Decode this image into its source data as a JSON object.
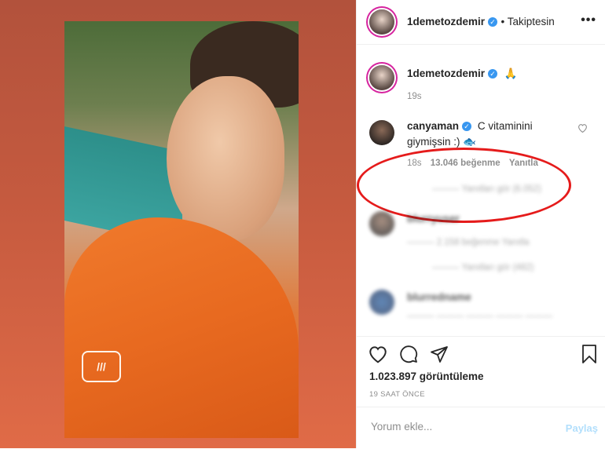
{
  "post": {
    "author": "1demetozdemir",
    "follow_label": "• Takiptesin",
    "more_label": "•••"
  },
  "caption": {
    "author": "1demetozdemir",
    "emoji": "🙏",
    "time": "19s"
  },
  "highlighted_comment": {
    "author": "canyaman",
    "text_line1": "C vitaminini",
    "text_line2": "giymişsin :)",
    "emoji": "🐟",
    "time": "18s",
    "likes": "13.046 beğenme",
    "reply": "Yanıtla"
  },
  "blurred_comments": [
    {
      "line": "——— Yanıtları gör (6.052)"
    },
    {
      "author": "blurryuser",
      "line": "——— 2.158 beğenme  Yanıtla"
    },
    {
      "line": "——— Yanıtları gör (482)"
    },
    {
      "author": "blurredname",
      "line": "——— ——— ——— ——— ———"
    }
  ],
  "stats": {
    "views": "1.023.897 görüntüleme",
    "ago": "19 SAAT ÖNCE"
  },
  "composer": {
    "placeholder": "Yorum ekle...",
    "post_label": "Paylaş"
  },
  "colors": {
    "verified": "#3897f0",
    "highlight": "#e51b1b",
    "post_button_disabled": "#b2dffc"
  },
  "icons": {
    "like": "heart-icon",
    "comment": "comment-icon",
    "share": "send-icon",
    "save": "bookmark-icon",
    "verified": "verified-badge-icon"
  }
}
